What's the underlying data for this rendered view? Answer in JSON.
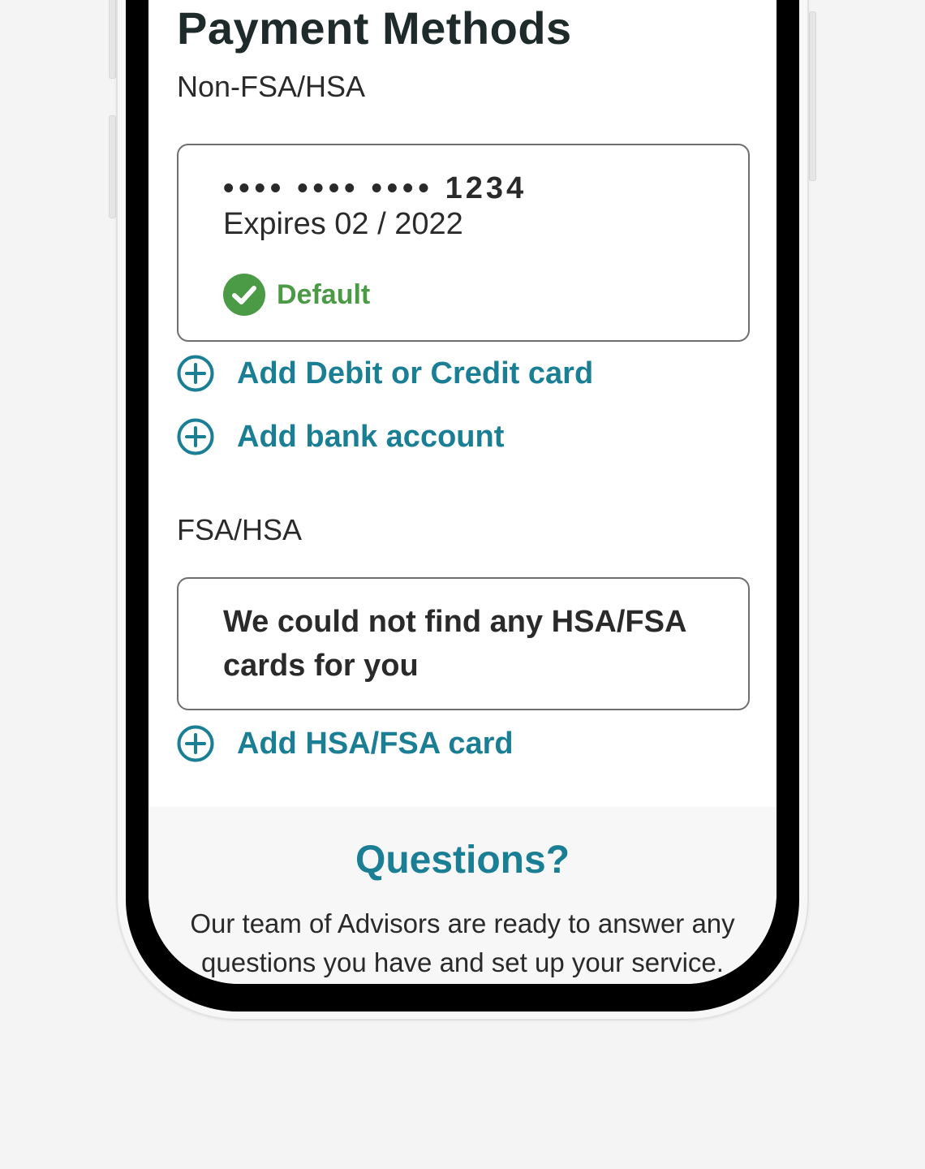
{
  "page": {
    "title": "Payment Methods"
  },
  "non_fsa": {
    "section_label": "Non-FSA/HSA",
    "card": {
      "masked_groups": [
        "••••",
        "••••",
        "••••"
      ],
      "last_four": "1234",
      "expiry": "Expires 02 / 2022",
      "default_label": "Default",
      "default_icon": "check-circle-icon"
    },
    "add_card_label": "Add Debit or Credit card",
    "add_bank_label": "Add bank account"
  },
  "fsa": {
    "section_label": "FSA/HSA",
    "empty_message": "We could not find any HSA/FSA cards for you",
    "add_card_label": "Add HSA/FSA card"
  },
  "questions": {
    "title": "Questions?",
    "text": "Our team of Advisors are ready to answer any questions you have and set up your service."
  },
  "colors": {
    "accent": "#1a7e95",
    "success": "#4a9a46",
    "text": "#2a2a2a"
  }
}
